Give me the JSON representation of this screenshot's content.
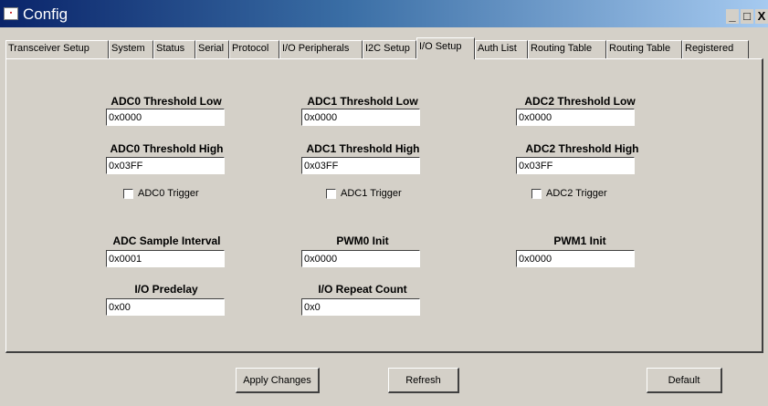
{
  "window": {
    "title": "Config",
    "icon": "app-icon",
    "controls": [
      "_",
      "□",
      "X"
    ]
  },
  "tabs": [
    {
      "label": "Transceiver Setup"
    },
    {
      "label": "System"
    },
    {
      "label": "Status"
    },
    {
      "label": "Serial"
    },
    {
      "label": "Protocol"
    },
    {
      "label": "I/O Peripherals"
    },
    {
      "label": "I2C Setup"
    },
    {
      "label": "I/O Setup",
      "active": true
    },
    {
      "label": "Auth List"
    },
    {
      "label": "Routing Table"
    },
    {
      "label": "Routing Table"
    },
    {
      "label": "Registered"
    }
  ],
  "io_setup": {
    "adc0_low": {
      "label": "ADC0 Threshold Low",
      "value": "0x0000"
    },
    "adc1_low": {
      "label": "ADC1 Threshold Low",
      "value": "0x0000"
    },
    "adc2_low": {
      "label": "ADC2 Threshold Low",
      "value": "0x0000"
    },
    "adc0_high": {
      "label": "ADC0 Threshold High",
      "value": "0x03FF"
    },
    "adc1_high": {
      "label": "ADC1 Threshold High",
      "value": "0x03FF"
    },
    "adc2_high": {
      "label": "ADC2 Threshold High",
      "value": "0x03FF"
    },
    "adc0_trigger": {
      "label": "ADC0 Trigger",
      "checked": false
    },
    "adc1_trigger": {
      "label": "ADC1 Trigger",
      "checked": false
    },
    "adc2_trigger": {
      "label": "ADC2 Trigger",
      "checked": false
    },
    "sample_interval": {
      "label": "ADC Sample Interval",
      "value": "0x0001"
    },
    "pwm0_init": {
      "label": "PWM0 Init",
      "value": "0x0000"
    },
    "pwm1_init": {
      "label": "PWM1 Init",
      "value": "0x0000"
    },
    "io_predelay": {
      "label": "I/O Predelay",
      "value": "0x00"
    },
    "io_repeat_count": {
      "label": "I/O Repeat Count",
      "value": "0x0"
    }
  },
  "buttons": {
    "apply": "Apply Changes",
    "refresh": "Refresh",
    "default": "Default"
  }
}
